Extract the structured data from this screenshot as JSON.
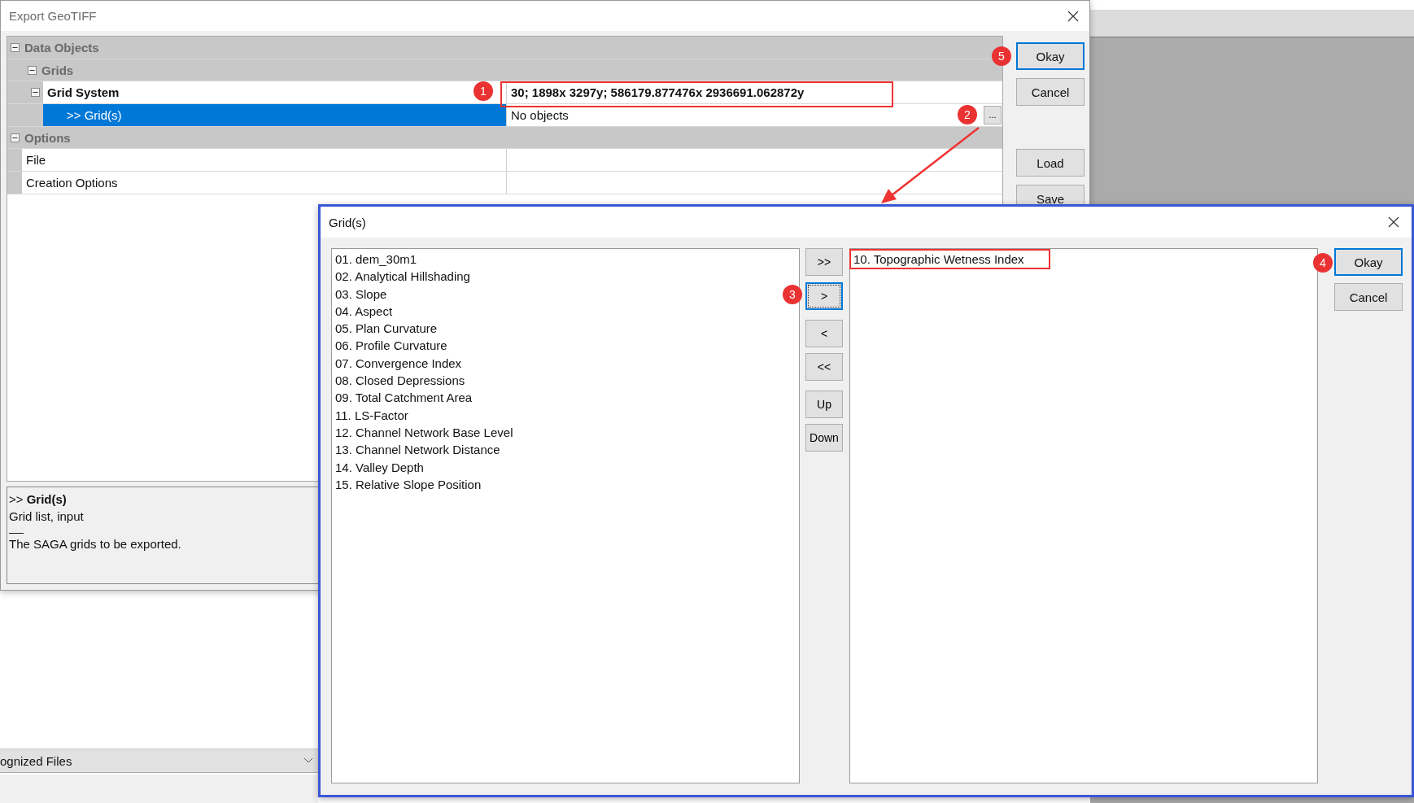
{
  "background_app": {
    "dropdown": {
      "value": "ognized Files"
    }
  },
  "export_dialog": {
    "title": "Export GeoTIFF",
    "property_grid": {
      "rows": [
        {
          "kind": "category",
          "name": "Data Objects",
          "expanded": true,
          "children": [
            {
              "kind": "category",
              "name": "Grids",
              "expanded": true,
              "children": [
                {
                  "kind": "parent",
                  "name": "Grid System",
                  "value": "30; 1898x 3297y; 586179.877476x 2936691.062872y",
                  "expanded": true,
                  "selected": false,
                  "children": [
                    {
                      "kind": "property",
                      "name": ">> Grid(s)",
                      "value": "No objects",
                      "button": "...",
                      "selected": true
                    }
                  ]
                }
              ]
            }
          ]
        },
        {
          "kind": "category",
          "name": "Options",
          "expanded": true,
          "children": [
            {
              "kind": "property",
              "name": "File",
              "selected": false
            },
            {
              "kind": "property",
              "name": "Creation Options",
              "selected": false
            }
          ]
        }
      ]
    },
    "description": {
      "title": ">> **Grid(s)**",
      "type": "Grid list, input",
      "text": "The SAGA grids to be exported."
    },
    "buttons": [
      {
        "label": "Okay",
        "default": true
      },
      {
        "label": "Cancel",
        "default": false
      },
      {
        "label": "Load",
        "default": false
      },
      {
        "label": "Save",
        "default": false
      }
    ]
  },
  "grids_dialog": {
    "title": "Grid(s)",
    "available": [
      "01. dem_30m1",
      "02. Analytical Hillshading",
      "03. Slope",
      "04. Aspect",
      "05. Plan Curvature",
      "06. Profile Curvature",
      "07. Convergence Index",
      "08. Closed Depressions",
      "09. Total Catchment Area",
      "11. LS-Factor",
      "12. Channel Network Base Level",
      "13. Channel Network Distance",
      "14. Valley Depth",
      "15. Relative Slope Position"
    ],
    "chosen": [
      "10. Topographic Wetness Index"
    ],
    "move_buttons": [
      {
        "label": ">>",
        "focused": false
      },
      {
        "label": ">",
        "focused": true
      },
      {
        "label": "<",
        "focused": false
      },
      {
        "label": "<<",
        "focused": false
      },
      {
        "label": "Up",
        "focused": false
      },
      {
        "label": "Down",
        "focused": false
      }
    ],
    "buttons": [
      {
        "label": "Okay",
        "default": true
      },
      {
        "label": "Cancel",
        "default": false
      }
    ]
  },
  "annotations": [
    {
      "number": "1"
    },
    {
      "number": "2"
    },
    {
      "number": "3"
    },
    {
      "number": "4"
    },
    {
      "number": "5"
    }
  ]
}
